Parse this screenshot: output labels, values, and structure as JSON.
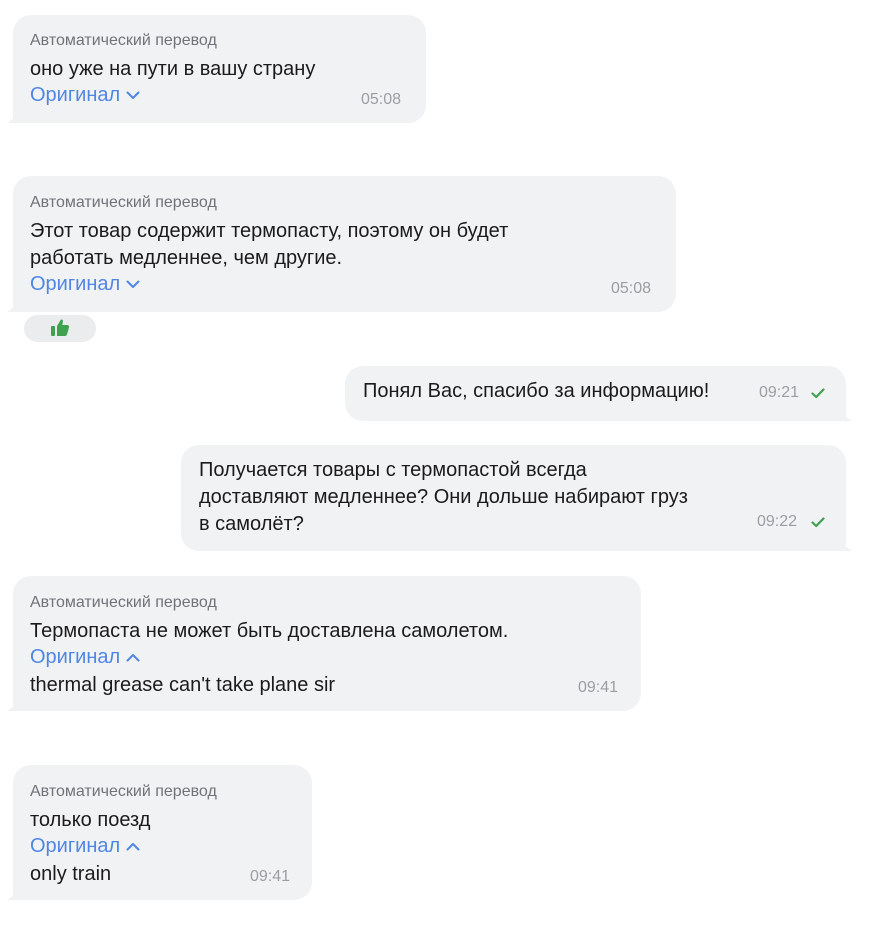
{
  "colors": {
    "bubble": "#f1f2f4",
    "link": "#4f86e3",
    "check": "#3fa052",
    "thumb": "#3ea34f"
  },
  "messages": [
    {
      "direction": "incoming",
      "label": "Автоматический перевод",
      "text": "оно уже на пути в вашу страну",
      "original_toggle": "Оригинал",
      "toggle_state": "collapsed",
      "time": "05:08"
    },
    {
      "direction": "incoming",
      "label": "Автоматический перевод",
      "text_lines": [
        "Этот товар содержит термопасту, поэтому он будет",
        "работать медленнее, чем другие."
      ],
      "original_toggle": "Оригинал",
      "toggle_state": "collapsed",
      "time": "05:08",
      "reaction": "thumbs-up-icon"
    },
    {
      "direction": "outgoing",
      "text": "Понял Вас, спасибо за информацию!",
      "time": "09:21",
      "status": "check-icon"
    },
    {
      "direction": "outgoing",
      "text_lines": [
        "Получается товары с термопастой всегда",
        "доставляют медленнее? Они дольше набирают груз",
        "в самолёт?"
      ],
      "time": "09:22",
      "status": "check-icon"
    },
    {
      "direction": "incoming",
      "label": "Автоматический перевод",
      "text": "Термопаста не может быть доставлена самолетом.",
      "original_toggle": "Оригинал",
      "toggle_state": "expanded",
      "original_text": "thermal grease can't take plane sir",
      "time": "09:41"
    },
    {
      "direction": "incoming",
      "label": "Автоматический перевод",
      "text": "только поезд",
      "original_toggle": "Оригинал",
      "toggle_state": "expanded",
      "original_text": "only train",
      "time": "09:41"
    }
  ]
}
